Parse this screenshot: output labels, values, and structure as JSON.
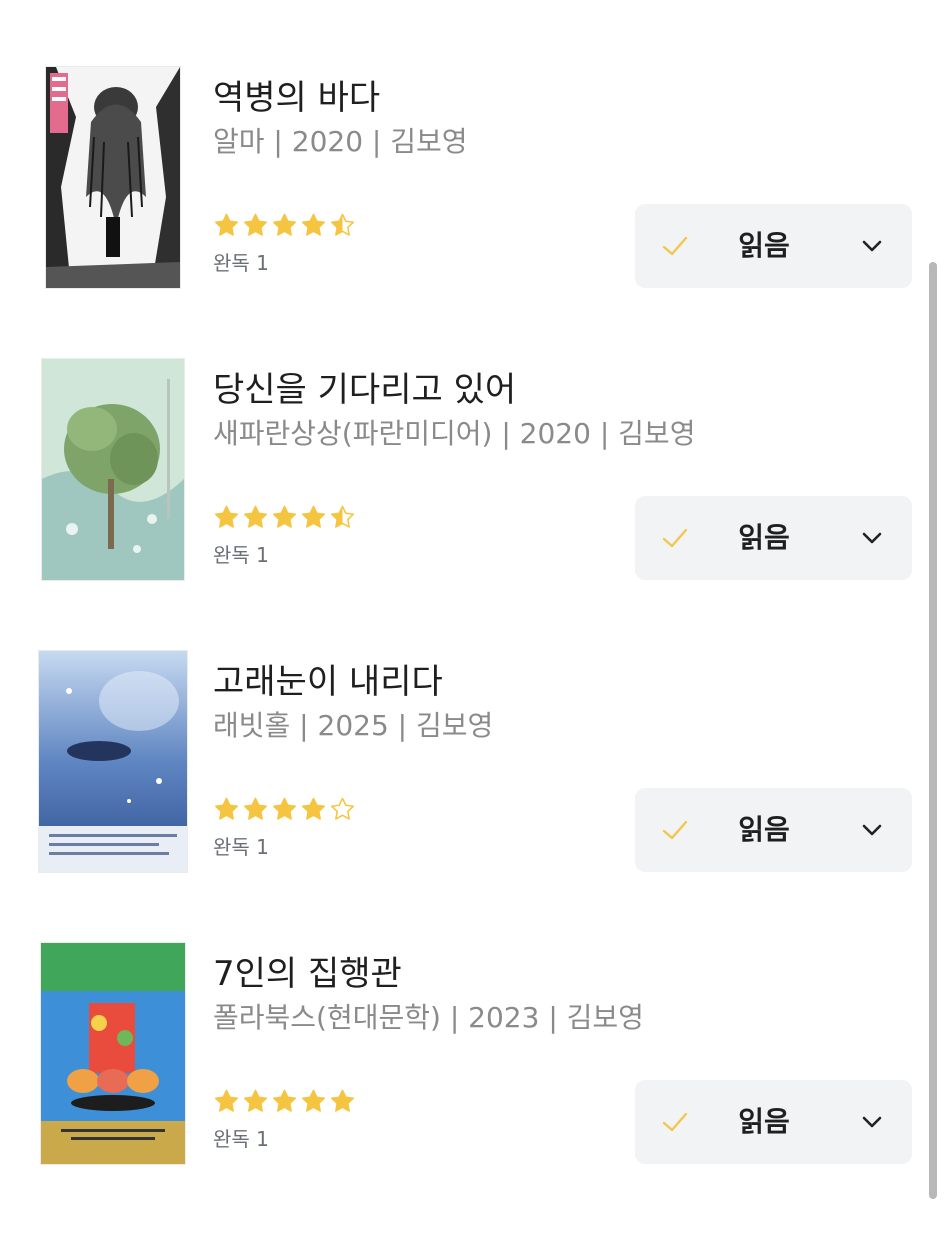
{
  "books": [
    {
      "title": "역병의 바다",
      "meta": "알마 | 2020 | 김보영",
      "rating": 4.5,
      "read_count": "완독 1",
      "status_label": "읽음",
      "status_icon": "check-icon",
      "dropdown_icon": "chevron-down-icon"
    },
    {
      "title": "당신을 기다리고 있어",
      "meta": "새파란상상(파란미디어) | 2020 | 김보영",
      "rating": 4.5,
      "read_count": "완독 1",
      "status_label": "읽음",
      "status_icon": "check-icon",
      "dropdown_icon": "chevron-down-icon"
    },
    {
      "title": "고래눈이 내리다",
      "meta": "래빗홀 | 2025 | 김보영",
      "rating": 4,
      "read_count": "완독 1",
      "status_label": "읽음",
      "status_icon": "check-icon",
      "dropdown_icon": "chevron-down-icon"
    },
    {
      "title": "7인의 집행관",
      "meta": "폴라북스(현대문학) | 2023 | 김보영",
      "rating": 5,
      "read_count": "완독 1",
      "status_label": "읽음",
      "status_icon": "check-icon",
      "dropdown_icon": "chevron-down-icon"
    }
  ],
  "colors": {
    "star": "#f5c542",
    "check": "#f3c64d",
    "button_bg": "#f2f3f5",
    "meta_text": "#8a8a8a"
  }
}
